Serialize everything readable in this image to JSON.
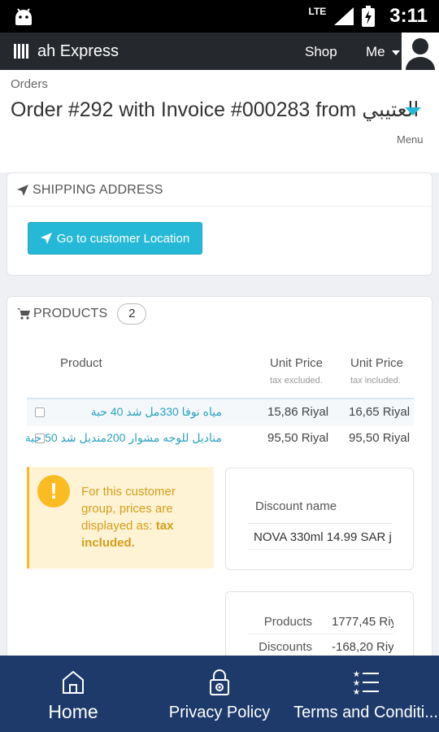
{
  "status_bar": {
    "network": "LTE",
    "time": "3:11"
  },
  "topnav": {
    "brand": "ah Express",
    "shop": "Shop",
    "me": "Me"
  },
  "header": {
    "breadcrumb": "Orders",
    "title": "Order #292 with Invoice #000283 from مة العتيبي",
    "menu_label": "Menu"
  },
  "shipping": {
    "heading": "Shipping address",
    "button_label": "Go to customer Location"
  },
  "products": {
    "heading": "Products",
    "count": "2",
    "columns": {
      "product": "Product",
      "unit_price_ex": "Unit Price",
      "unit_price_ex_sub": "tax excluded.",
      "unit_price_inc": "Unit Price",
      "unit_price_inc_sub": "tax included."
    },
    "rows": [
      {
        "name": "مياه نوفا 330مل شد 40 حبة",
        "price_ex": "15,86 Riyal",
        "price_inc": "16,65 Riyal"
      },
      {
        "name": "مناديل للوجه مشوار 200منديل شد 50 حبة",
        "price_ex": "95,50 Riyal",
        "price_inc": "95,50 Riyal"
      }
    ]
  },
  "alert": {
    "text": "For this customer group, prices are displayed as:",
    "emphasis": "tax included."
  },
  "discount": {
    "header": "Discount name",
    "value": "NOVA 330ml 14.99 SAR j"
  },
  "totals": {
    "rows": [
      {
        "label": "Products",
        "value": "1777,45 Riy"
      },
      {
        "label": "Discounts",
        "value": "-168,20 Riy"
      }
    ]
  },
  "bottom_nav": {
    "items": [
      {
        "label": "Home",
        "icon": "home-icon"
      },
      {
        "label": "Privacy Policy",
        "icon": "lock-icon"
      },
      {
        "label": "Terms and Conditi...",
        "icon": "list-icon"
      }
    ]
  },
  "colors": {
    "accent": "#25b9d7",
    "nav_dark": "#25282d",
    "bottom_nav": "#1e3a6b",
    "warning": "#fbbb22"
  }
}
